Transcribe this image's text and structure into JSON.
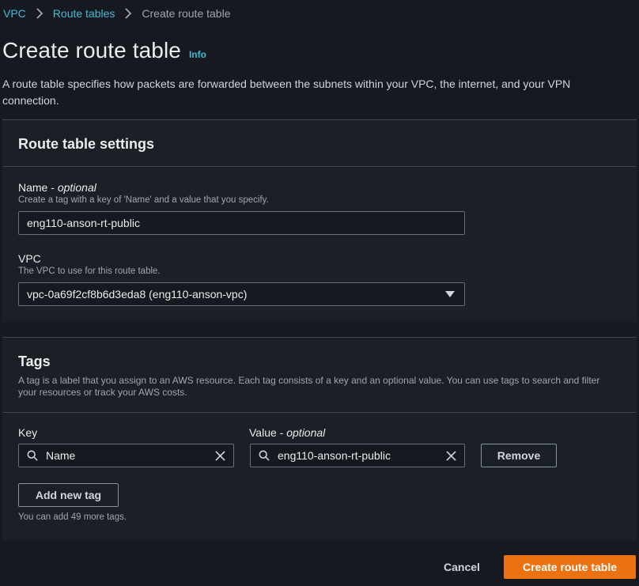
{
  "breadcrumb": {
    "items": [
      "VPC",
      "Route tables"
    ],
    "current": "Create route table"
  },
  "page": {
    "title": "Create route table",
    "info": "Info",
    "description": "A route table specifies how packets are forwarded between the subnets within your VPC, the internet, and your VPN connection."
  },
  "settings": {
    "heading": "Route table settings",
    "name": {
      "label": "Name",
      "label_suffix": "optional",
      "description": "Create a tag with a key of 'Name' and a value that you specify.",
      "value": "eng110-anson-rt-public"
    },
    "vpc": {
      "label": "VPC",
      "description": "The VPC to use for this route table.",
      "selected": "vpc-0a69f2cf8b6d3eda8 (eng110-anson-vpc)"
    }
  },
  "tags": {
    "heading": "Tags",
    "description": "A tag is a label that you assign to an AWS resource. Each tag consists of a key and an optional value. You can use tags to search and filter your resources or track your AWS costs.",
    "key_label": "Key",
    "value_label": "Value",
    "value_label_suffix": "optional",
    "rows": [
      {
        "key": "Name",
        "value": "eng110-anson-rt-public",
        "remove_label": "Remove"
      }
    ],
    "add_label": "Add new tag",
    "limit_hint": "You can add 49 more tags."
  },
  "footer": {
    "cancel": "Cancel",
    "create": "Create route table"
  },
  "colors": {
    "background": "#16191f",
    "panel": "#1b1f26",
    "link": "#44b9d6",
    "primary": "#ec7211"
  },
  "icons": [
    "chevron-right-icon",
    "search-icon",
    "clear-icon",
    "caret-down-icon"
  ]
}
